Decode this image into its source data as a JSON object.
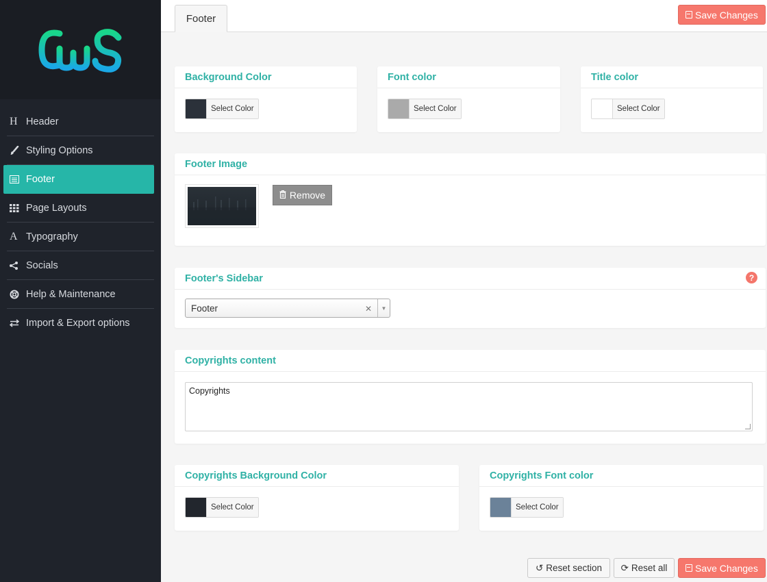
{
  "brand": {
    "logo_text": "CwS",
    "logo_colors": [
      "#19d68a",
      "#1aa8e6"
    ]
  },
  "sidebar": {
    "items": [
      {
        "label": "Header",
        "icon": "header-h-icon",
        "active": false
      },
      {
        "label": "Styling Options",
        "icon": "brush-icon",
        "active": false
      },
      {
        "label": "Footer",
        "icon": "footer-list-icon",
        "active": true
      },
      {
        "label": "Page Layouts",
        "icon": "grid-icon",
        "active": false
      },
      {
        "label": "Typography",
        "icon": "font-a-icon",
        "active": false
      },
      {
        "label": "Socials",
        "icon": "share-icon",
        "active": false
      },
      {
        "label": "Help & Maintenance",
        "icon": "lifebuoy-icon",
        "active": false
      },
      {
        "label": "Import & Export options",
        "icon": "exchange-icon",
        "active": false
      }
    ]
  },
  "header": {
    "tab_label": "Footer",
    "save_label": "Save Changes"
  },
  "colors": {
    "accent": "#2fb1a5",
    "save": "#f6776c"
  },
  "sections": {
    "background_color": {
      "title": "Background Color",
      "button": "Select Color",
      "swatch": "#2b313a"
    },
    "font_color": {
      "title": "Font color",
      "button": "Select Color",
      "swatch": "#aaaaaa"
    },
    "title_color": {
      "title": "Title color",
      "button": "Select Color",
      "swatch": "#ffffff"
    },
    "footer_image": {
      "title": "Footer Image",
      "remove_label": "Remove"
    },
    "footer_sidebar": {
      "title": "Footer's Sidebar",
      "selected": "Footer",
      "help": "?"
    },
    "copyrights_content": {
      "title": "Copyrights content",
      "value": "Copyrights"
    },
    "copyrights_bg": {
      "title": "Copyrights Background Color",
      "button": "Select Color",
      "swatch": "#22262d"
    },
    "copyrights_font": {
      "title": "Copyrights Font color",
      "button": "Select Color",
      "swatch": "#6b8299"
    }
  },
  "footer_actions": {
    "reset_section": "Reset section",
    "reset_all": "Reset all",
    "save": "Save Changes"
  }
}
